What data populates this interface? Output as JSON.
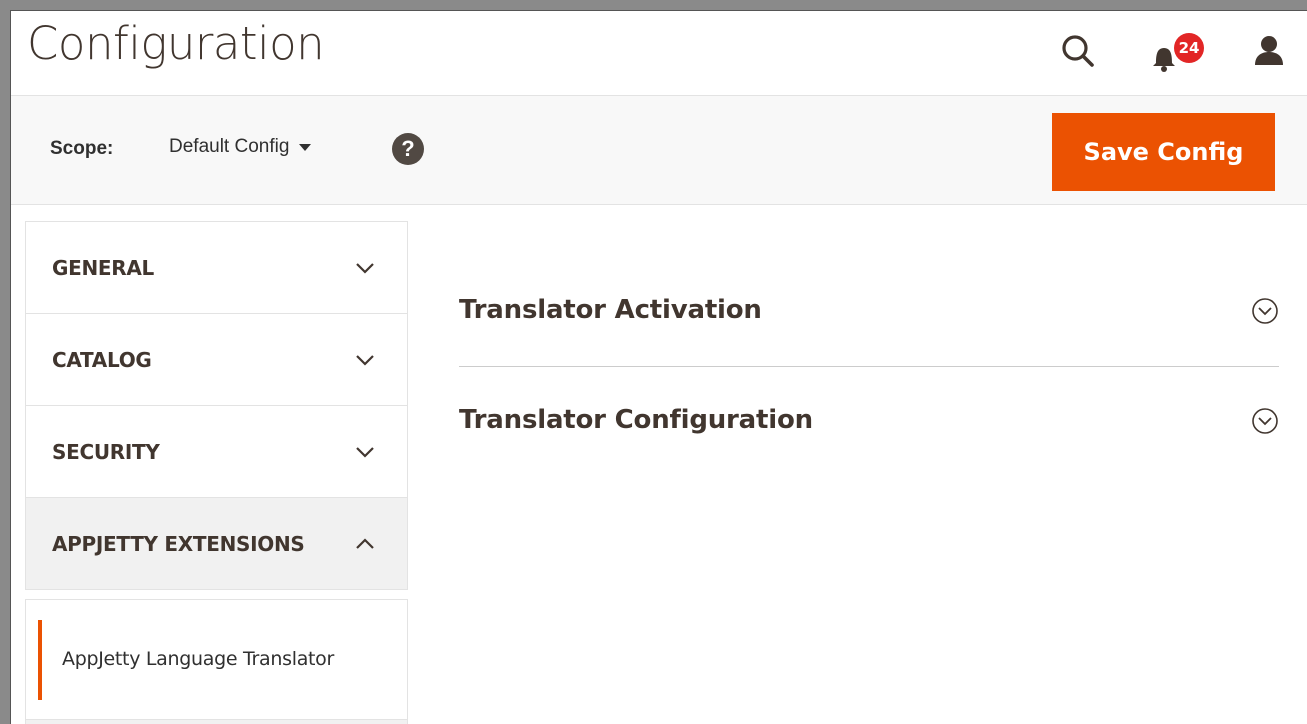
{
  "header": {
    "title": "Configuration",
    "notifications_count": "24",
    "icons": [
      "search-icon",
      "bell-icon",
      "user-icon"
    ]
  },
  "scope": {
    "label": "Scope:",
    "value": "Default Config",
    "help": "?"
  },
  "actions": {
    "save_label": "Save Config"
  },
  "sidebar": {
    "items": [
      {
        "label": "GENERAL",
        "expanded": false
      },
      {
        "label": "CATALOG",
        "expanded": false
      },
      {
        "label": "SECURITY",
        "expanded": false
      },
      {
        "label": "APPJETTY EXTENSIONS",
        "expanded": true
      }
    ],
    "sub_items": [
      {
        "label": "AppJetty Language Translator",
        "active": true
      }
    ]
  },
  "main": {
    "sections": [
      {
        "title": "Translator Activation"
      },
      {
        "title": "Translator Configuration"
      }
    ]
  },
  "colors": {
    "accent": "#eb5202",
    "badge": "#e22626",
    "text": "#41362f"
  }
}
